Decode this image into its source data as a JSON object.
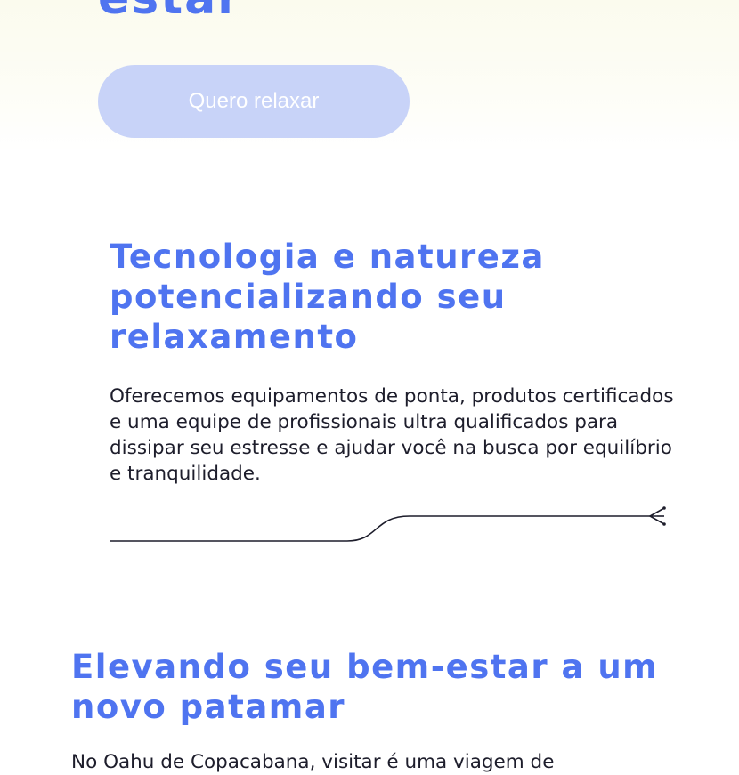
{
  "hero": {
    "title_fragment": "estar",
    "cta_label": "Quero relaxar"
  },
  "section_technology": {
    "title": "Tecnologia e natureza potencializando seu relaxamento",
    "text": "Oferecemos equipamentos de ponta, produtos certificados e uma equipe de profissionais ultra qualificados para dissipar seu estresse e ajudar você na busca por equilíbrio e tranquilidade."
  },
  "section_wellbeing": {
    "title": "Elevando seu bem-estar a um novo patamar",
    "text_partial": "No Oahu de Copacabana, visitar é uma viagem de"
  },
  "colors": {
    "accent": "#4f74f0",
    "button_bg": "#c8d3f8",
    "text": "#1d1d2b",
    "hero_bg": "#fbfbee"
  },
  "icons": {
    "divider": "arrow-tail-line-icon"
  }
}
